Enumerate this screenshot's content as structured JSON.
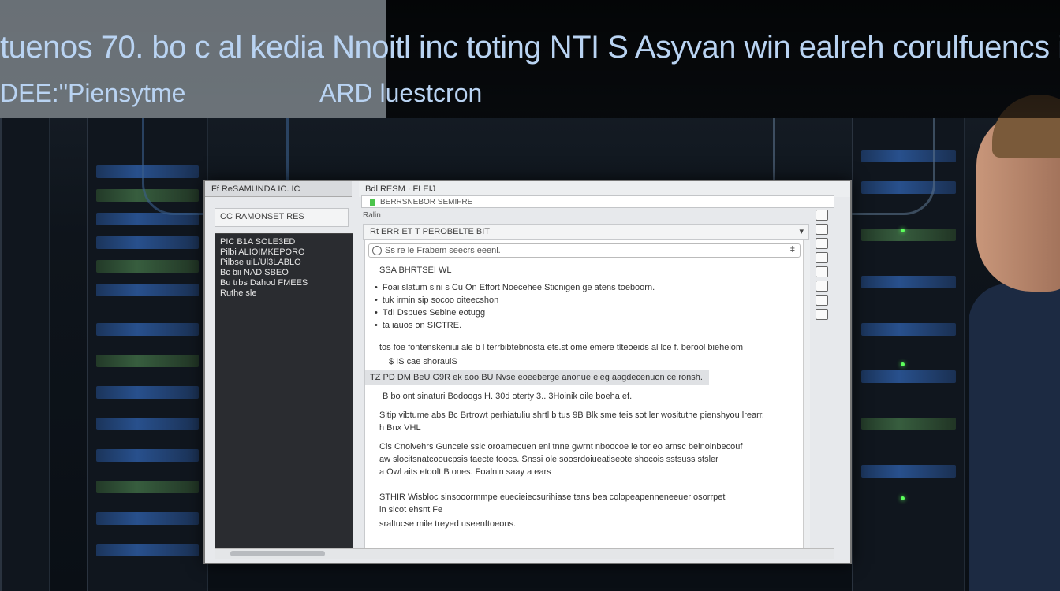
{
  "headline": {
    "line1": "tuenos 70. bo c al kedia Nnoitl inc toting NTI S Asyvan win ealreh corulfuencs in tienlo",
    "line2": "DEE:\"Piensytme",
    "line2b": "ARD luestcron"
  },
  "monitor": {
    "left_title": "Ff ReSAMUNDA IC. IC",
    "right_title": "Bdl  RESM  ·  FLEIJ",
    "address": "BERRSNEBOR SEMIFRE",
    "left_toolbar": "CC RAMONSET RES",
    "tab_label": "Ralin",
    "sub_toolbar": "Rt ERR ET T PEROBELTE BIT",
    "search_text": "Ss re le Frabem seecrs eeenl.",
    "tree": [
      "PIC B1A SOLE3ED",
      "Pilbi ALIOIMKEPORO",
      "Pilbse uiL/Ul3LABLO",
      "Bc bii NAD SBEO",
      "Bu trbs Dahod FMEES",
      "Ruthe sle"
    ],
    "doc": {
      "heading": "SSA BHRTSEI WL",
      "bullets": [
        "Foai slatum sini s Cu On Effort Noecehee Sticnigen ge atens toeboorn.",
        "tuk irmin sip socoo oiteecshon",
        "TdI Dspues Sebine eotugg",
        "ta iauos on SICTRE."
      ],
      "para1a": "tos foe fontenskeniui ale b l terrbibtebnosta ets.st ome emere tlteoeids al lce f. berool biehelom",
      "para1b": "$ IS cae shoraulS",
      "highlight": "TZ PD DM BeU G9R ek aoo BU Nvse eoeeberge anonue eieg aagdecenuon ce ronsh.",
      "para2": "B bo ont sinaturi Bodoogs H. 30d oterty 3.. 3Hoinik oile boeha ef.",
      "para3a": "Sitip vibtume abs Bc Brtrowt perhiatuliu shrtl b tus  9B Blk sme teis sot ler wosituthe pienshyou lrearr.",
      "para3b": "h Bnx VHL",
      "para4a": "Cis Cnoivehrs Guncele ssic oroamecuen eni  tnne gwrnt nboocoe ie tor eo arnsc beinoinbecouf",
      "para4b": "aw slocitsnatcooucpsis taecte toocs. Snssi ole soosrdoiueatiseote shocois sstsuss stsler",
      "para4c": "a Owl aits etoolt B ones. Foalnin saay a ears",
      "para5a": "STHIR Wisbloc sinsooormmpe euecieiecsurihiase tans bea colopeapenneneeuer osorrpet",
      "para5b": "in sicot ehsnt  Fe",
      "para5c": "sraltucse mile treyed useenftoeons."
    }
  },
  "colors": {
    "headline": "#b9d3f2",
    "led": "#5cff5c",
    "screen_bg": "#e7e9ec",
    "dark_panel": "#2a2c30"
  }
}
